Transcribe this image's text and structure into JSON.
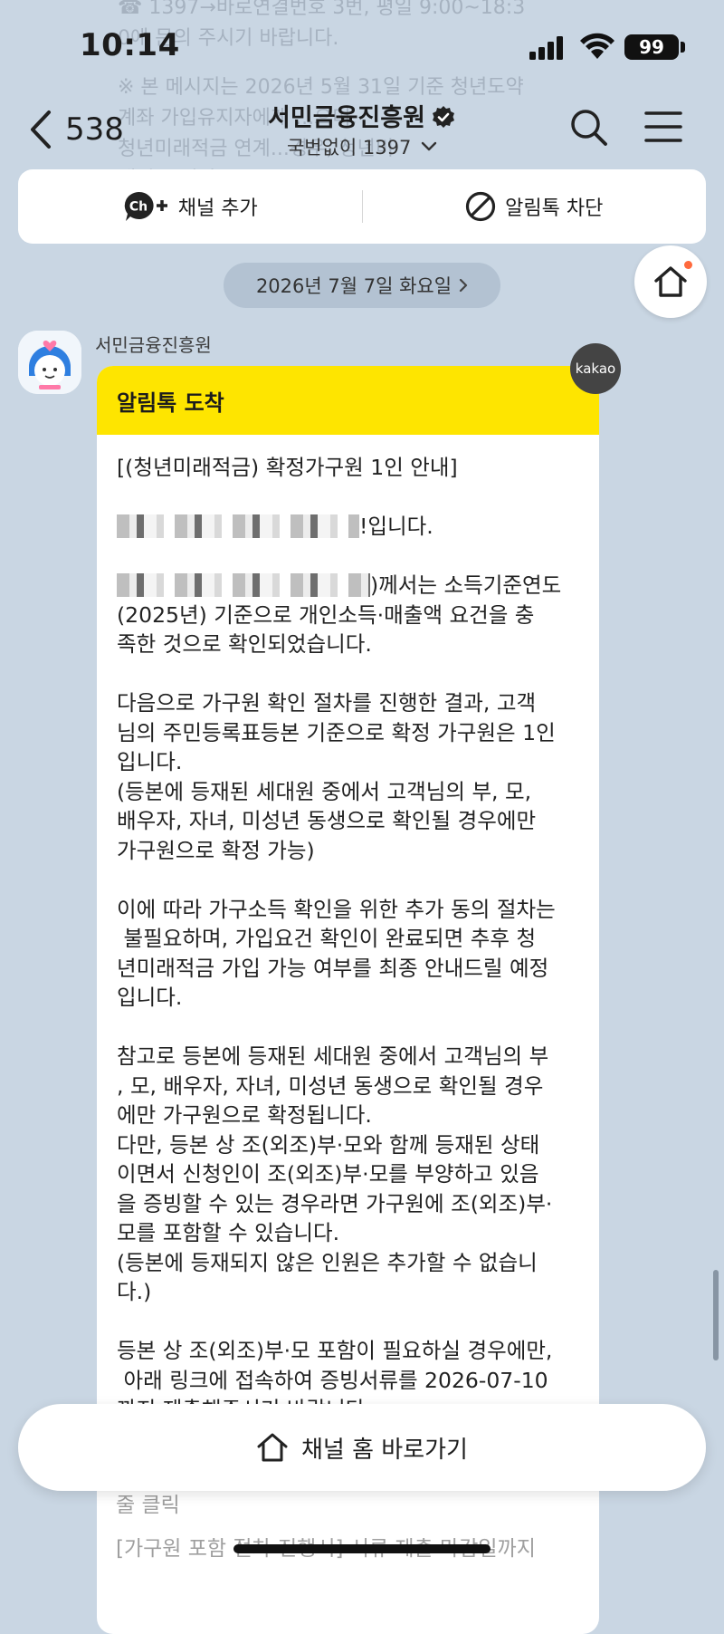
{
  "status_bar": {
    "time": "10:14",
    "battery": "99"
  },
  "background_ghost": {
    "line1": "☎ 1397→바로연결번호 3번, 평일 9:00~18:3\n0에 문의 주시기 바랍니다.",
    "line2": "※ 본 메시지는 2026년 5월 31일 기준 청년도약\n계좌 가입유지자에게 ...으며,\n청년미래적금 연계...경우, 청년미\n래적금 개설 ..."
  },
  "header": {
    "back_count": "538",
    "title": "서민금융진흥원",
    "subtitle": "국번없이 1397"
  },
  "action_bar": {
    "add_channel": "채널 추가",
    "block_alimtalk": "알림톡 차단"
  },
  "date_divider": "2026년 7월 7일 화요일",
  "message": {
    "sender": "서민금융진흥원",
    "badge": "kakao",
    "header": "알림톡 도착",
    "title": "[(청년미래적금) 확정가구원 1인 안내]",
    "greeting_suffix": "!입니다.",
    "p1_suffix": ")께서는 소득기준연도\n(2025년) 기준으로 개인소득·매출액 요건을 충\n족한 것으로 확인되었습니다.",
    "p2": "다음으로 가구원 확인 절차를 진행한 결과, 고객\n님의 주민등록표등본 기준으로 확정 가구원은 1인\n입니다.\n(등본에 등재된 세대원 중에서 고객님의 부, 모,\n배우자, 자녀, 미성년 동생으로 확인될 경우에만\n가구원으로 확정 가능)",
    "p3": "이에 따라 가구소득 확인을 위한 추가 동의 절차는\n 불필요하며, 가입요건 확인이 완료되면 추후 청\n년미래적금 가입 가능 여부를 최종 안내드릴 예정\n입니다.",
    "p4": "참고로 등본에 등재된 세대원 중에서 고객님의 부\n, 모, 배우자, 자녀, 미성년 동생으로 확인될 경우\n에만 가구원으로 확정됩니다.\n다만, 등본 상 조(외조)부·모와 함께 등재된 상태\n이면서 신청인이 조(외조)부·모를 부양하고 있음\n을 증빙할 수 있는 경우라면 가구원에 조(외조)부·\n모를 포함할 수 있습니다.\n(등본에 등재되지 않은 인원은 추가할 수 없습니\n다.)",
    "p5": "등본 상 조(외조)부·모 포함이 필요하실 경우에만,\n 아래 링크에 접속하여 증빙서류를 2026-07-10\n까지 제출해주시기 바랍니다.\n* 단, 건강보험자격확인(통보)서 상 신청인이 가"
  },
  "below_button": {
    "line1": "줄 클릭",
    "line2": "[가구원 포함 절차 진행시] 서류 제출 마감일까지"
  },
  "home_shortcut": "채널 홈 바로가기"
}
